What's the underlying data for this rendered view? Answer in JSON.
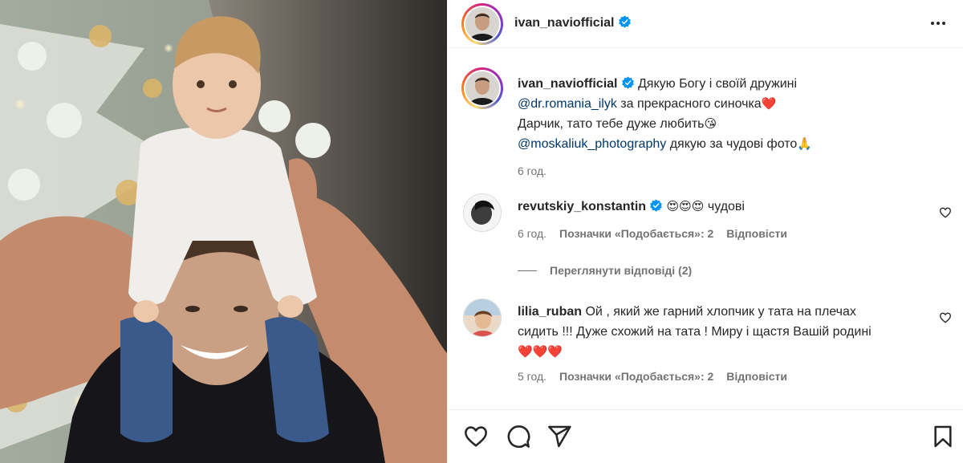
{
  "post": {
    "author": "ivan_naviofficial",
    "verified": true
  },
  "caption": {
    "author": "ivan_naviofficial",
    "text1": "Дякую Богу і своїй дружині",
    "mention1": "@dr.romania_ilyk",
    "text2": "за прекрасного синочка",
    "heart": "❤️",
    "text3": "Дарчик, тато тебе дуже любить",
    "wink": "😘",
    "mention2": "@moskaliuk_photography",
    "text4": "дякую за чудові фото",
    "pray": "🙏",
    "time": "6 год."
  },
  "comments": [
    {
      "author": "revutskiy_konstantin",
      "verified": true,
      "emoji": "😍😍😍",
      "text": "чудові",
      "time": "6 год.",
      "likes": "Позначки «Подобається»: 2",
      "reply": "Відповісти"
    },
    {
      "author": "lilia_ruban",
      "verified": false,
      "text_line1": "Ой , який же гарний хлопчик у тата на плечах",
      "text_line2": "сидить !!! Дуже схожий на тата ! Миру і щастя Вашій родині",
      "hearts": "❤️❤️❤️",
      "time": "5 год.",
      "likes": "Позначки «Подобається»: 2",
      "reply": "Відповісти"
    }
  ],
  "view_replies": "Переглянути відповіді (2)",
  "icons": {
    "more": "more-options-icon",
    "like": "heart-icon",
    "comment": "comment-icon",
    "share": "paper-plane-icon",
    "save": "bookmark-icon",
    "verified": "verified-badge-icon"
  },
  "colors": {
    "verified": "#0095f6",
    "mention": "#00376b",
    "meta": "#737373"
  }
}
